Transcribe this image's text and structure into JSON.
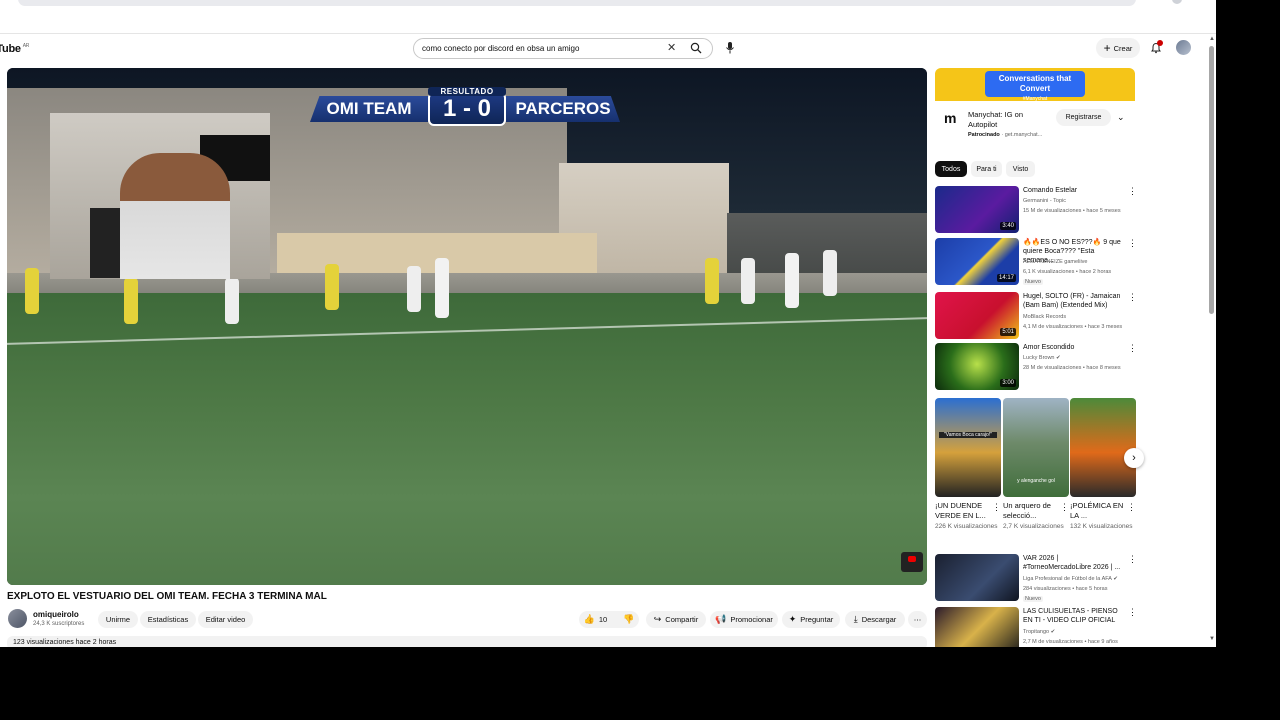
{
  "masthead": {
    "logo_text": "uTube",
    "logo_region": "AR",
    "search_value": "como conecto por discord en obsa un amigo",
    "create_label": "Crear",
    "colors": {
      "badge": "#cc0000"
    }
  },
  "player": {
    "score": {
      "label": "RESULTADO",
      "home_team": "OMI TEAM",
      "away_team": "PARCEROS",
      "home_score": "1",
      "away_score": "0"
    }
  },
  "video": {
    "title": "EXPLOTO EL VESTUARIO DEL OMI TEAM. FECHA 3 TERMINA MAL",
    "channel": "omiqueirolo",
    "subscribers": "24,3 K suscriptores",
    "join_label": "Unirme",
    "stats_label": "Estadísticas",
    "edit_label": "Editar video",
    "likes": "10",
    "share_label": "Compartir",
    "promote_label": "Promocionar",
    "ask_label": "Preguntar",
    "download_label": "Descargar",
    "description_preview": "123 visualizaciones  hace 2 horas"
  },
  "ad": {
    "banner_title": "Conversations that Convert",
    "banner_handle": "#Manychat",
    "title": "Manychat: IG on Autopilot",
    "sponsored": "Patrocinado",
    "domain": "get.manychat...",
    "cta": "Registrarse"
  },
  "chips": [
    "Todos",
    "Para ti",
    "Visto"
  ],
  "recommendations": [
    {
      "title": "Comando Estelar",
      "channel": "Germanini - Topic",
      "meta": "15 M de visualizaciones • hace 5 meses",
      "duration": "3:40",
      "badge": ""
    },
    {
      "title": "🔥🔥ES O NO ES???🔥 9 que quiere Boca???? \"Esta semana...",
      "channel": "ALMA XENEIZE gameliive",
      "meta": "6,1 K visualizaciones • hace 2 horas",
      "duration": "14:17",
      "badge": "Nuevo"
    },
    {
      "title": "Hugel, SOLTO (FR) - Jamaican (Bam Bam) (Extended Mix)",
      "channel": "MoBlack Records",
      "meta": "4,1 M de visualizaciones • hace 3 meses",
      "duration": "5:01",
      "badge": ""
    },
    {
      "title": "Amor Escondido",
      "channel": "Lucky Brown",
      "meta": "28 M de visualizaciones • hace 8 meses",
      "duration": "3:00",
      "badge": ""
    },
    {
      "title": "VAR 2026 | #TorneoMercadoLibre 2026 | ...",
      "channel": "Liga Profesional de Fútbol de la AFA",
      "meta": "284 visualizaciones • hace 5 horas",
      "duration": "",
      "badge": "Nuevo"
    },
    {
      "title": "LAS CULISUELTAS - PIENSO EN TI - VIDEO CLIP OFICIAL",
      "channel": "Tropitango",
      "meta": "2,7 M de visualizaciones • hace 9 años",
      "duration": "",
      "badge": ""
    }
  ],
  "shorts": [
    {
      "title": "¡UN DUENDE VERDE EN L...",
      "views": "226 K visualizaciones",
      "overlay": "\"Vamos Boca carajo!\""
    },
    {
      "title": "Un arquero de selecció...",
      "views": "2,7 K visualizaciones",
      "overlay": "y alenganche gol"
    },
    {
      "title": "¡POLÉMICA EN LA ...",
      "views": "132 K visualizaciones",
      "overlay": ""
    }
  ]
}
